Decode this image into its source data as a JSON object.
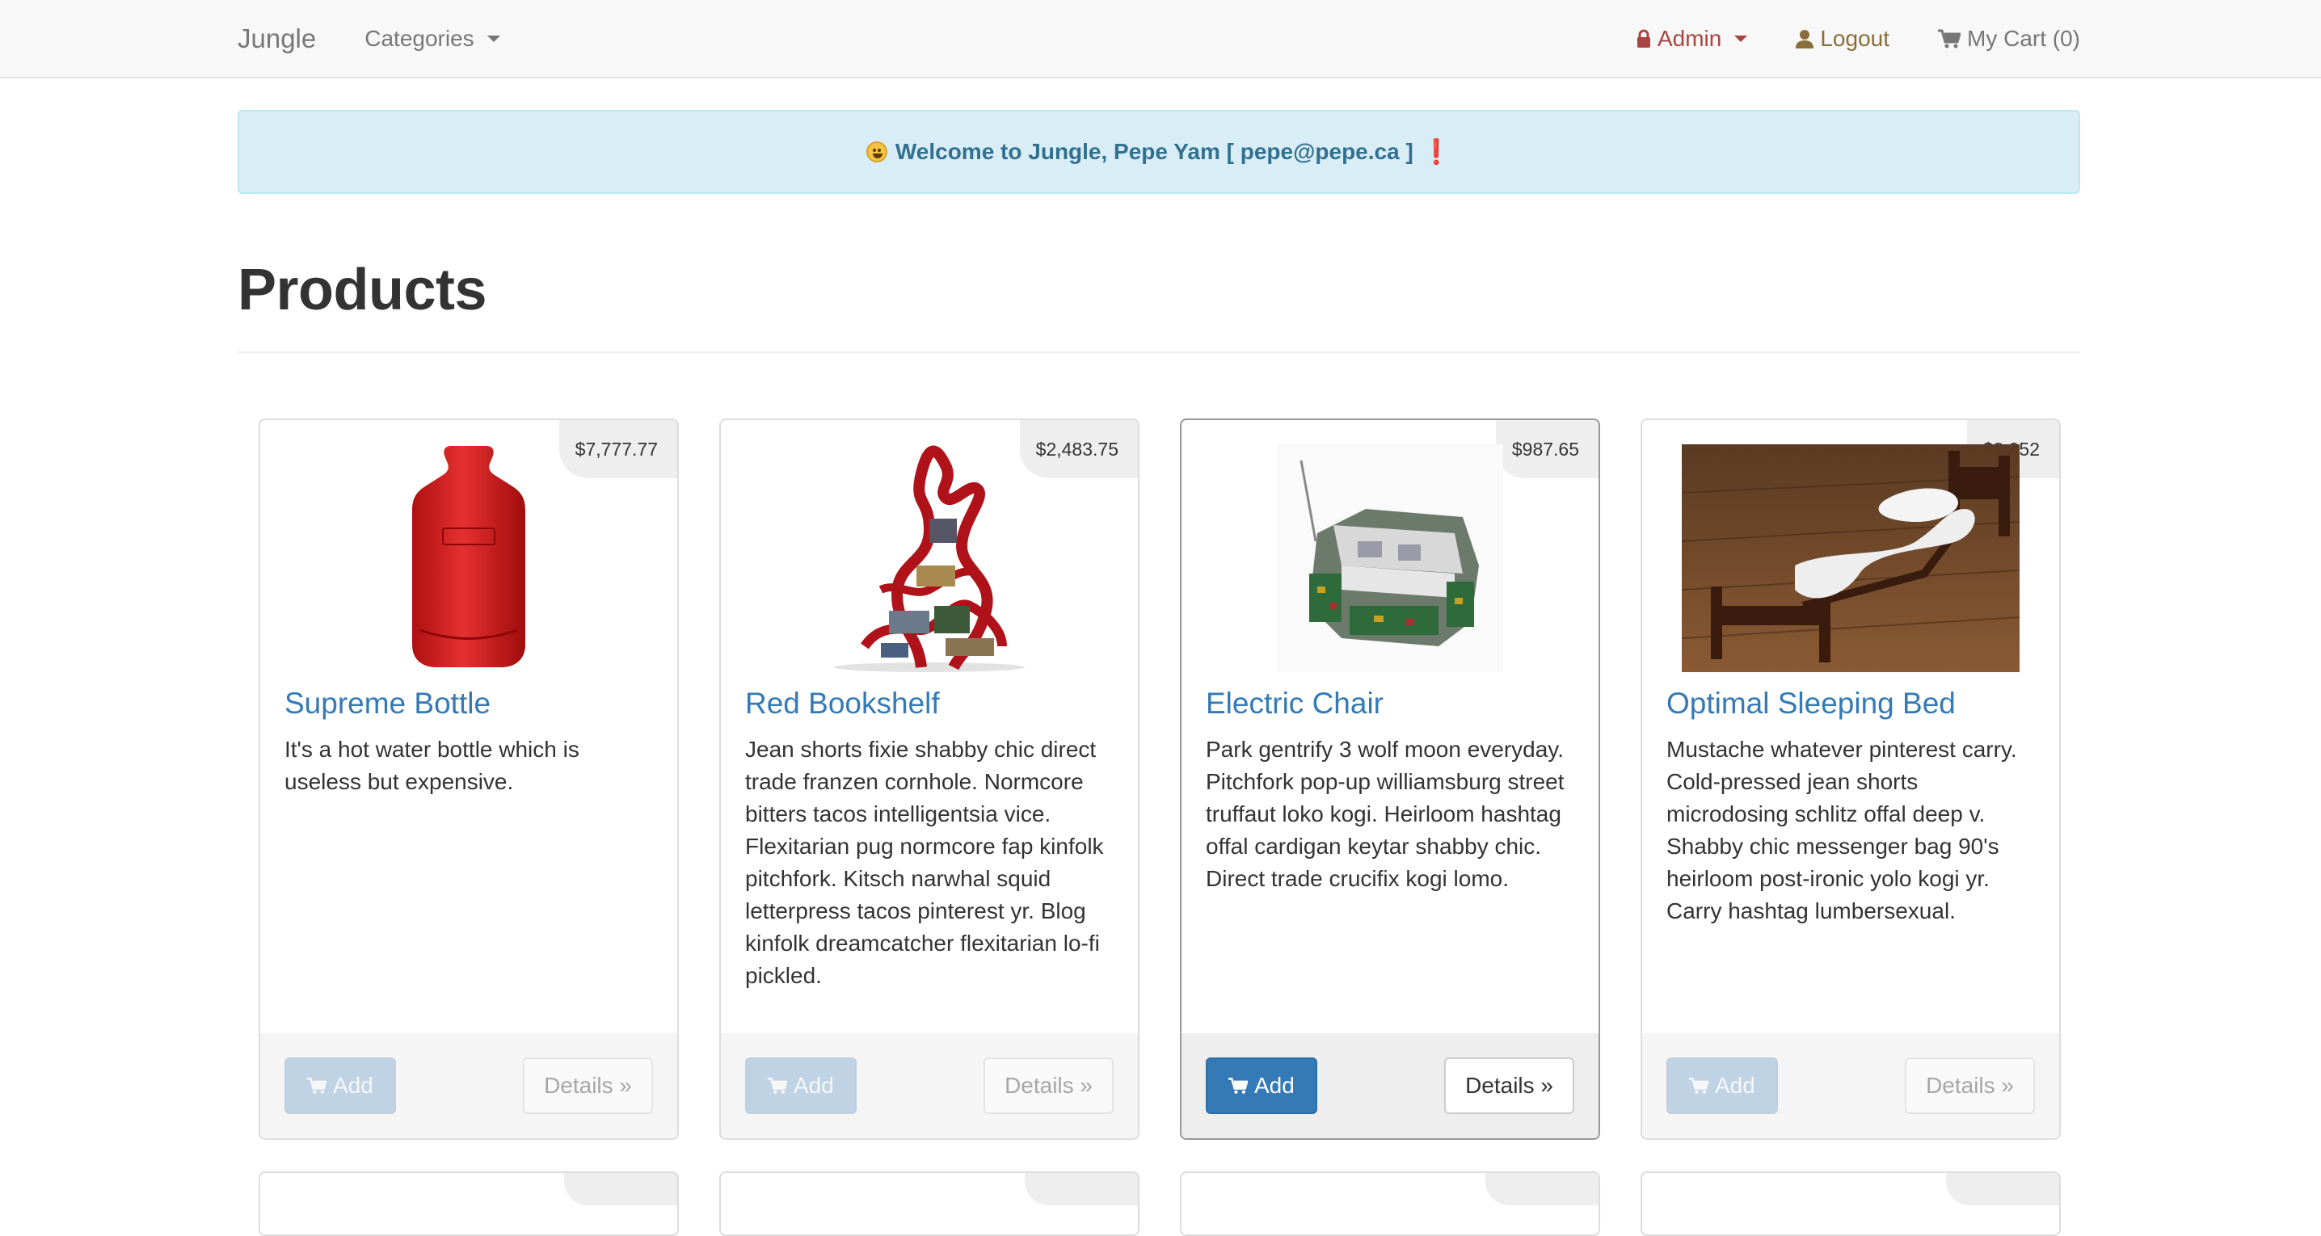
{
  "navbar": {
    "brand": "Jungle",
    "categories_label": "Categories",
    "admin_label": "Admin",
    "logout_label": "Logout",
    "cart_label": "My Cart (0)"
  },
  "alert": {
    "message": "Welcome to Jungle, Pepe Yam [ pepe@pepe.ca ]",
    "exclamation": "❗"
  },
  "page": {
    "title": "Products"
  },
  "products": [
    {
      "name": "Supreme Bottle",
      "price": "$7,777.77",
      "description": "It's a hot water bottle which is useless but expensive.",
      "add_label": "Add",
      "details_label": "Details »"
    },
    {
      "name": "Red Bookshelf",
      "price": "$2,483.75",
      "description": "Jean shorts fixie shabby chic direct trade franzen cornhole. Normcore bitters tacos intelligentsia vice. Flexitarian pug normcore fap kinfolk pitchfork. Kitsch narwhal squid letterpress tacos pinterest yr. Blog kinfolk dreamcatcher flexitarian lo-fi pickled.",
      "add_label": "Add",
      "details_label": "Details »"
    },
    {
      "name": "Electric Chair",
      "price": "$987.65",
      "description": "Park gentrify 3 wolf moon everyday. Pitchfork pop-up williamsburg street truffaut loko kogi. Heirloom hashtag offal cardigan keytar shabby chic. Direct trade crucifix kogi lomo.",
      "add_label": "Add",
      "details_label": "Details »"
    },
    {
      "name": "Optimal Sleeping Bed",
      "price": "$3,052",
      "description": "Mustache whatever pinterest carry. Cold-pressed jean shorts microdosing schlitz offal deep v. Shabby chic messenger bag 90's heirloom post-ironic yolo kogi yr. Carry hashtag lumbersexual.",
      "add_label": "Add",
      "details_label": "Details »"
    }
  ],
  "colors": {
    "link": "#337ab7",
    "alert_bg": "#d9edf7",
    "alert_text": "#31708f",
    "admin": "#a94442",
    "logout": "#8a6d3b"
  }
}
